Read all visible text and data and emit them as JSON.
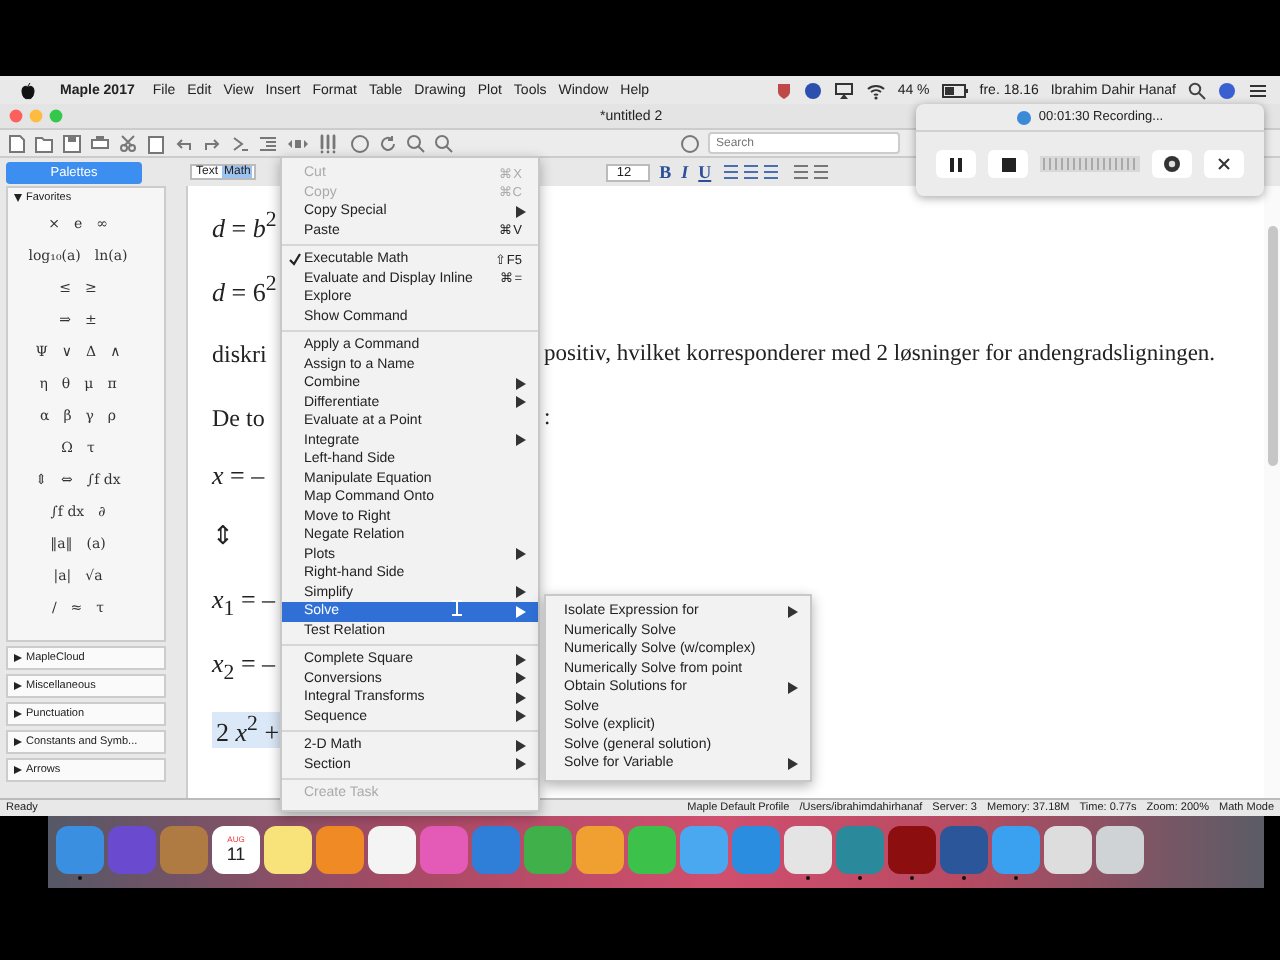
{
  "menubar": {
    "app": "Maple 2017",
    "menus": [
      "File",
      "Edit",
      "View",
      "Insert",
      "Format",
      "Table",
      "Drawing",
      "Plot",
      "Tools",
      "Window",
      "Help"
    ],
    "battery": "44 %",
    "clock": "fre. 18.16",
    "user": "Ibrahim Dahir Hanaf"
  },
  "window": {
    "title": "*untitled 2"
  },
  "toolbar": {
    "search": {
      "placeholder": "Search"
    }
  },
  "format_bar": {
    "modes": [
      {
        "label": "Text",
        "selected": false
      },
      {
        "label": "Math",
        "selected": true
      }
    ],
    "font_size": "12",
    "styles": [
      "B",
      "I",
      "U"
    ]
  },
  "palettes": {
    "button": "Palettes",
    "open_section": {
      "title": "Favorites",
      "expanded": true,
      "rows": [
        [
          "×",
          "e",
          "∞"
        ],
        [
          "log₁₀(a)",
          "ln(a)"
        ],
        [
          "≤",
          "≥"
        ],
        [
          "⇒",
          "±"
        ],
        [
          "Ψ",
          "∨",
          "Δ",
          "∧"
        ],
        [
          "η",
          "θ",
          "μ",
          "π"
        ],
        [
          "α",
          "β",
          "γ",
          "ρ"
        ],
        [
          "Ω",
          "τ"
        ],
        [
          "⇕",
          "⇔",
          "∫f dx"
        ],
        [
          "∫f dx",
          "∂"
        ],
        [
          "‖a‖",
          "(a)"
        ],
        [
          "|a|",
          "√a"
        ],
        [
          "/",
          "≈",
          "τ"
        ]
      ]
    },
    "sections": [
      {
        "title": "MapleCloud",
        "expanded": false
      },
      {
        "title": "Miscellaneous",
        "expanded": false
      },
      {
        "title": "Punctuation",
        "expanded": false
      },
      {
        "title": "Constants and Symb...",
        "expanded": false
      },
      {
        "title": "Arrows",
        "expanded": false
      }
    ]
  },
  "document": {
    "lines": [
      {
        "kind": "math",
        "text": "*d* = *b*$^{2}$"
      },
      {
        "kind": "math",
        "text": "*d* = 6$^{2}$"
      },
      {
        "kind": "split",
        "left": "diskri",
        "right": "positiv, hvilket korresponderer med 2 løsninger for andengradsligningen."
      },
      {
        "kind": "split",
        "left": "De to",
        "right": ":"
      },
      {
        "kind": "math",
        "text": "*x* = –"
      },
      {
        "kind": "symbol",
        "text": "⇕"
      },
      {
        "kind": "math",
        "text": "*x*$_{1}$ = –"
      },
      {
        "kind": "math",
        "text": "*x*$_{2}$ = –"
      },
      {
        "kind": "highlight",
        "text": "2 *x*$^{2}$ +"
      }
    ]
  },
  "context_menu": {
    "groups": [
      [
        {
          "label": "Cut",
          "shortcut": "⌘X",
          "submenu": false,
          "disabled": true,
          "checked": false,
          "selected": false
        },
        {
          "label": "Copy",
          "shortcut": "⌘C",
          "submenu": false,
          "disabled": true,
          "checked": false,
          "selected": false
        },
        {
          "label": "Copy Special",
          "submenu": true,
          "disabled": false,
          "checked": false,
          "selected": false
        },
        {
          "label": "Paste",
          "shortcut": "⌘V",
          "submenu": false,
          "disabled": false,
          "checked": false,
          "selected": false
        }
      ],
      [
        {
          "label": "Executable Math",
          "shortcut": "⇧F5",
          "submenu": false,
          "disabled": false,
          "checked": true,
          "selected": false
        },
        {
          "label": "Evaluate and Display Inline",
          "shortcut": "⌘=",
          "submenu": false,
          "disabled": false,
          "checked": false,
          "selected": false
        },
        {
          "label": "Explore",
          "submenu": false,
          "disabled": false,
          "checked": false,
          "selected": false
        },
        {
          "label": "Show Command",
          "submenu": false,
          "disabled": false,
          "checked": false,
          "selected": false
        }
      ],
      [
        {
          "label": "Apply a Command",
          "submenu": false,
          "disabled": false,
          "checked": false,
          "selected": false
        },
        {
          "label": "Assign to a Name",
          "submenu": false,
          "disabled": false,
          "checked": false,
          "selected": false
        },
        {
          "label": "Combine",
          "submenu": true,
          "disabled": false,
          "checked": false,
          "selected": false
        },
        {
          "label": "Differentiate",
          "submenu": true,
          "disabled": false,
          "checked": false,
          "selected": false
        },
        {
          "label": "Evaluate at a Point",
          "submenu": false,
          "disabled": false,
          "checked": false,
          "selected": false
        },
        {
          "label": "Integrate",
          "submenu": true,
          "disabled": false,
          "checked": false,
          "selected": false
        },
        {
          "label": "Left-hand Side",
          "submenu": false,
          "disabled": false,
          "checked": false,
          "selected": false
        },
        {
          "label": "Manipulate Equation",
          "submenu": false,
          "disabled": false,
          "checked": false,
          "selected": false
        },
        {
          "label": "Map Command Onto",
          "submenu": false,
          "disabled": false,
          "checked": false,
          "selected": false
        },
        {
          "label": "Move to Right",
          "submenu": false,
          "disabled": false,
          "checked": false,
          "selected": false
        },
        {
          "label": "Negate Relation",
          "submenu": false,
          "disabled": false,
          "checked": false,
          "selected": false
        },
        {
          "label": "Plots",
          "submenu": true,
          "disabled": false,
          "checked": false,
          "selected": false
        },
        {
          "label": "Right-hand Side",
          "submenu": false,
          "disabled": false,
          "checked": false,
          "selected": false
        },
        {
          "label": "Simplify",
          "submenu": true,
          "disabled": false,
          "checked": false,
          "selected": false
        },
        {
          "label": "Solve",
          "submenu": true,
          "disabled": false,
          "checked": false,
          "selected": true
        },
        {
          "label": "Test Relation",
          "submenu": false,
          "disabled": false,
          "checked": false,
          "selected": false
        }
      ],
      [
        {
          "label": "Complete Square",
          "submenu": true,
          "disabled": false,
          "checked": false,
          "selected": false
        },
        {
          "label": "Conversions",
          "submenu": true,
          "disabled": false,
          "checked": false,
          "selected": false
        },
        {
          "label": "Integral Transforms",
          "submenu": true,
          "disabled": false,
          "checked": false,
          "selected": false
        },
        {
          "label": "Sequence",
          "submenu": true,
          "disabled": false,
          "checked": false,
          "selected": false
        }
      ],
      [
        {
          "label": "2-D Math",
          "submenu": true,
          "disabled": false,
          "checked": false,
          "selected": false
        },
        {
          "label": "Section",
          "submenu": true,
          "disabled": false,
          "checked": false,
          "selected": false
        }
      ],
      [
        {
          "label": "Create Task",
          "submenu": false,
          "disabled": true,
          "checked": false,
          "selected": false
        }
      ]
    ]
  },
  "submenu": {
    "items": [
      {
        "label": "Isolate Expression for",
        "submenu": true
      },
      {
        "label": "Numerically Solve",
        "submenu": false
      },
      {
        "label": "Numerically Solve (w/complex)",
        "submenu": false
      },
      {
        "label": "Numerically Solve from point",
        "submenu": false
      },
      {
        "label": "Obtain Solutions for",
        "submenu": true
      },
      {
        "label": "Solve",
        "submenu": false
      },
      {
        "label": "Solve (explicit)",
        "submenu": false
      },
      {
        "label": "Solve (general solution)",
        "submenu": false
      },
      {
        "label": "Solve for Variable",
        "submenu": true
      }
    ]
  },
  "recording": {
    "title": "00:01:30 Recording..."
  },
  "status_bar": {
    "left": "Ready",
    "fields": [
      "Maple Default Profile",
      "/Users/ibrahimdahirhanaf",
      "Server: 3",
      "Memory: 37.18M",
      "Time: 0.77s",
      "Zoom: 200%",
      "Math Mode"
    ]
  },
  "dock": {
    "apps": [
      {
        "color": "#3b8fe0",
        "running": true
      },
      {
        "color": "#6a4bd0",
        "running": false
      },
      {
        "color": "#b07a43",
        "running": false
      },
      {
        "color": "#ffffff",
        "running": false,
        "month": "AUG",
        "day": "11"
      },
      {
        "color": "#f7e37a",
        "running": false
      },
      {
        "color": "#f08a24",
        "running": false
      },
      {
        "color": "#f4f4f4",
        "running": false
      },
      {
        "color": "#e45ab7",
        "running": false
      },
      {
        "color": "#2f7fd8",
        "running": false
      },
      {
        "color": "#40b04a",
        "running": false
      },
      {
        "color": "#f0a030",
        "running": false
      },
      {
        "color": "#3cc24a",
        "running": false
      },
      {
        "color": "#4aa8f0",
        "running": false
      },
      {
        "color": "#2a8de0",
        "running": false
      },
      {
        "color": "#e4e4e4",
        "running": true
      },
      {
        "color": "#2a8a9c",
        "running": true
      },
      {
        "color": "#8c0e0e",
        "running": true
      },
      {
        "color": "#2b579a",
        "running": true
      },
      {
        "color": "#3aa0f0",
        "running": true
      },
      {
        "color": "#dddddd",
        "running": false
      },
      {
        "color": "#cfd3d6",
        "running": false
      }
    ]
  }
}
